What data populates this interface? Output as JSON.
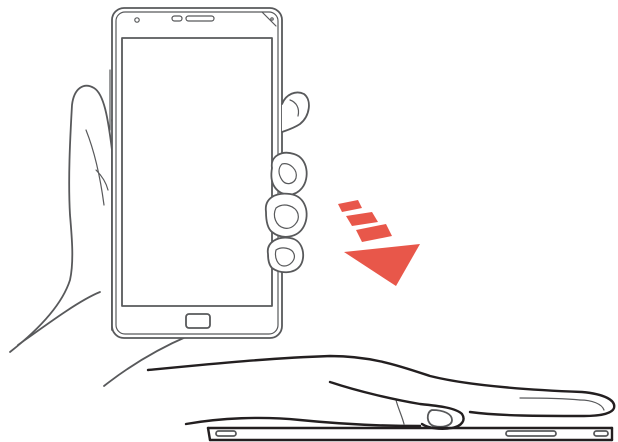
{
  "illustration": {
    "subject": "gesture-flip-phone-face-down-on-hand",
    "line_color": "#58595b",
    "dark_line_color": "#231f20",
    "arrow_color": "#e8574a",
    "background": "#ffffff",
    "arrow_direction": "down-right",
    "icons": [
      "phone-front-icon",
      "holding-hand-icon",
      "flip-arrow-icon",
      "flat-hand-icon",
      "phone-face-down-icon"
    ]
  }
}
